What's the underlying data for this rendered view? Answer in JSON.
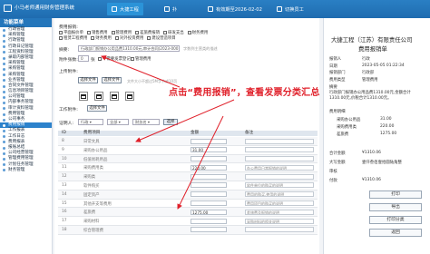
{
  "app": {
    "title": "小马老师通用财务管理系统",
    "topnav": [
      {
        "label": "大捷工程",
        "icon": "home-icon"
      },
      {
        "label": "扑"
      },
      {
        "label": "有效期至2026-02-02",
        "icon": "calendar-icon"
      },
      {
        "label": "切换员工",
        "icon": "user-icon"
      }
    ]
  },
  "sidebar": {
    "header": "功能菜单",
    "items": [
      "行政管理",
      "采购管理",
      "行政管理",
      "行政日记管理",
      "工程资料管理",
      "录取内部管理",
      "采购管理",
      "采购管理",
      "采购管理",
      "业务管理",
      "合同文件管理",
      "信息项目管理",
      "公司管理",
      "内部事务管理",
      "审计资料管理",
      "费用管理",
      "公司事务",
      "费用报销",
      "工作报表",
      "工作日志",
      "费用报表",
      "报账总结",
      "公司经营管理",
      "管理费用管理",
      "计划任务管理",
      "财务管理"
    ],
    "selected_index": 17
  },
  "form": {
    "type_label": "费用报销:",
    "options_row1": [
      "平面报价单",
      "销售费用",
      "管理费用",
      "差旅费报销",
      "研发支出",
      "财务费用"
    ],
    "options_row2": [
      "租赁工程费用",
      "财务费用",
      "对外投资费用",
      "建设营造项目"
    ],
    "summary_label": "摘要:",
    "summary_value": "行政部门报销办公用品费1310.00元,审计合同(2023-0001)",
    "summary_note": "字数到主营类的描述",
    "attach_label": "附件张数:",
    "attach_value": "0",
    "attach_unit": "张",
    "attach_opt1": "不需要发票登记",
    "attach_opt2": "管理费用",
    "upload_label": "上传附件:",
    "upload_btn": "选择文件",
    "upload_btn2": "选择文件",
    "upload_hint": "文件大小不超过5M字节或10页",
    "work_label": "工作附件:",
    "work_btn": "选择文件",
    "voucher_label": "证明人:",
    "voucher_placeholder": "行政 ▾",
    "dept_placeholder": "全部 ▾",
    "account_placeholder": "财务名 ▾",
    "search_btn": "选择"
  },
  "table": {
    "headers": [
      "ID",
      "费用项目",
      "",
      "金额",
      "备注"
    ],
    "rows": [
      {
        "id": "8",
        "name": "日常文具",
        "amount": "",
        "note": ""
      },
      {
        "id": "9",
        "name": "采购办公用品",
        "amount": "31.00",
        "note": ""
      },
      {
        "id": "10",
        "name": "低值易耗用品",
        "amount": "",
        "note": ""
      },
      {
        "id": "11",
        "name": "采购费用类",
        "amount": "220.00",
        "note": "办公费用日常报销的说明"
      },
      {
        "id": "12",
        "name": "采购类",
        "amount": "",
        "note": ""
      },
      {
        "id": "13",
        "name": "软件购买",
        "amount": "",
        "note": "软件单位的购买的说明"
      },
      {
        "id": "14",
        "name": "固定资产",
        "amount": "",
        "note": "费用的购买,使用的说明"
      },
      {
        "id": "15",
        "name": "其他开支等费用",
        "amount": "",
        "note": "费用项目的购买的说明"
      },
      {
        "id": "16",
        "name": "差旅费",
        "amount": "1275.00",
        "note": "差旅费及报销的说明"
      },
      {
        "id": "17",
        "name": "采购材料",
        "amount": "",
        "note": "采购材料的相关说明"
      },
      {
        "id": "18",
        "name": "综合管理费",
        "amount": "",
        "note": ""
      }
    ]
  },
  "callout": "点击“费用报销”，查看发票分类汇总",
  "panel": {
    "company": "大捷工程（江苏）有限责任公司",
    "doc_title": "费用报销单",
    "rows": [
      {
        "k": "报销人",
        "v": "行政"
      },
      {
        "k": "日期",
        "v": "2023-05-05 01:22:34"
      },
      {
        "k": "报销部门",
        "v": "行政部"
      },
      {
        "k": "费用类型",
        "v": "管理费用"
      }
    ],
    "summary_k": "摘要",
    "summary_v": "行政部门报销办公用品费1310.00元,金额合计1310.00元,价税合计1310.00元。",
    "items_header": "费用明细",
    "items": [
      {
        "k": "采购办公用品",
        "v": "31.00"
      },
      {
        "k": "采购费用类",
        "v": "220.00"
      },
      {
        "k": "差旅费",
        "v": "1275.00"
      }
    ],
    "total_k": "合计金额",
    "total_v": "¥1310.06",
    "upper_k": "大写金额",
    "upper_v": "壹仟叁佰壹拾圆陆角整",
    "audit_k": "审核",
    "audit_v": "",
    "pay_k": "付款",
    "pay_v": "¥1310.06",
    "btn1": "打印",
    "btn2": "导出",
    "btn3": "打印分类",
    "btn4": "返回"
  }
}
